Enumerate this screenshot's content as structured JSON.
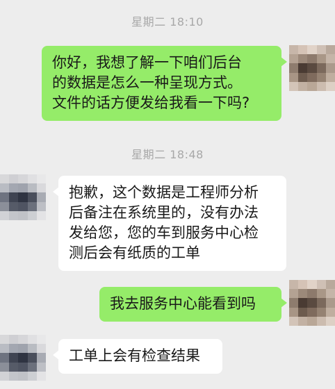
{
  "messages": [
    {
      "type": "timestamp",
      "text": "星期二 18:10"
    },
    {
      "type": "sent",
      "text": "你好，我想了解一下咱们后台\n的数据是怎么一种呈现方式。\n文件的话方便发给我看一下吗?"
    },
    {
      "type": "timestamp",
      "text": "星期二 18:48"
    },
    {
      "type": "received",
      "text": "抱歉，这个数据是工程师分析\n后备注在系统里的，没有办法\n发给您，您的车到服务中心检\n测后会有纸质的工单"
    },
    {
      "type": "sent",
      "text": "我去服务中心能看到吗"
    },
    {
      "type": "received",
      "text": "工单上会有检查结果"
    }
  ],
  "colors": {
    "background": "#ededed",
    "sent_bubble": "#95ec69",
    "received_bubble": "#ffffff",
    "timestamp_text": "#a8a8a8"
  }
}
